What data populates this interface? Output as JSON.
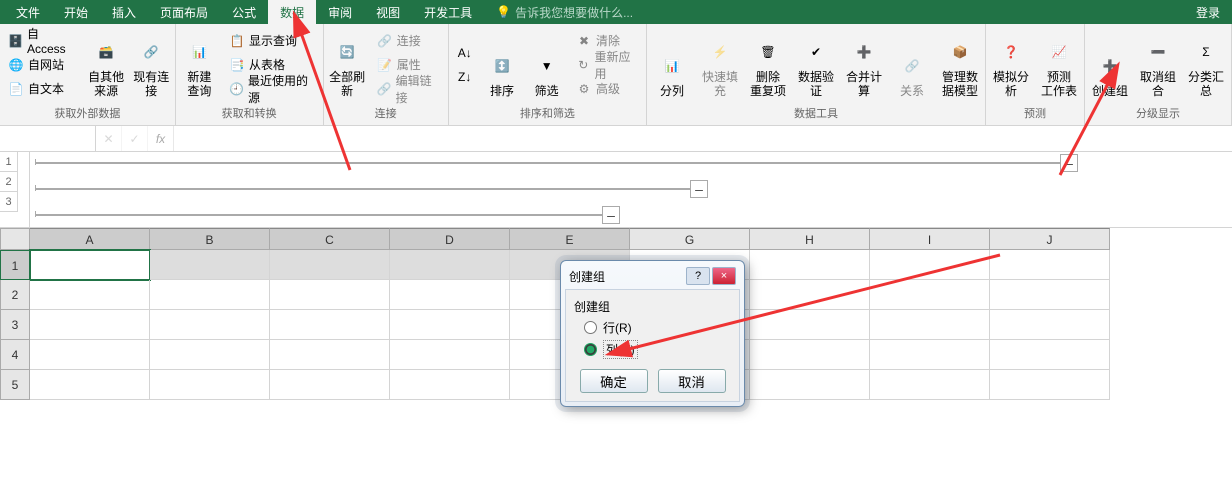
{
  "tabs": {
    "file": "文件",
    "home": "开始",
    "insert": "插入",
    "layout": "页面布局",
    "formula": "公式",
    "data": "数据",
    "review": "审阅",
    "view": "视图",
    "dev": "开发工具"
  },
  "tellme": "告诉我您想要做什么...",
  "login": "登录",
  "ribbon": {
    "ext_data": {
      "access": "自 Access",
      "web": "自网站",
      "text": "自文本",
      "other": "自其他来源",
      "existing": "现有连接",
      "label": "获取外部数据"
    },
    "newq": {
      "new": "新建\n查询",
      "show": "显示查询",
      "from_table": "从表格",
      "recent": "最近使用的源",
      "label": "获取和转换"
    },
    "conn": {
      "refresh": "全部刷新",
      "connections": "连接",
      "props": "属性",
      "editlinks": "编辑链接",
      "label": "连接"
    },
    "sort": {
      "az": "A→Z",
      "za": "Z→A",
      "sort": "排序",
      "filter": "筛选",
      "clear": "清除",
      "reapply": "重新应用",
      "advanced": "高级",
      "label": "排序和筛选"
    },
    "tools": {
      "t2c": "分列",
      "flash": "快速填充",
      "dup": "删除\n重复项",
      "valid": "数据验\n证",
      "consolidate": "合并计算",
      "rel": "关系",
      "model": "管理数\n据模型",
      "label": "数据工具"
    },
    "forecast": {
      "whatif": "模拟分析",
      "sheet": "预测\n工作表",
      "label": "预测"
    },
    "outline": {
      "group": "创建组",
      "ungroup": "取消组合",
      "subtotal": "分类汇总",
      "label": "分级显示"
    }
  },
  "fbar": {
    "name": "",
    "fx": "fx"
  },
  "outline_nums": [
    "1",
    "2",
    "3"
  ],
  "cols": [
    "A",
    "B",
    "C",
    "D",
    "E",
    "G",
    "H",
    "I",
    "J"
  ],
  "rows": [
    "1",
    "2",
    "3",
    "4",
    "5"
  ],
  "dialog": {
    "title": "创建组",
    "group": "创建组",
    "row": "行(R)",
    "col": "列(C)",
    "ok": "确定",
    "cancel": "取消",
    "help": "?",
    "close": "×"
  },
  "collapse": "–"
}
